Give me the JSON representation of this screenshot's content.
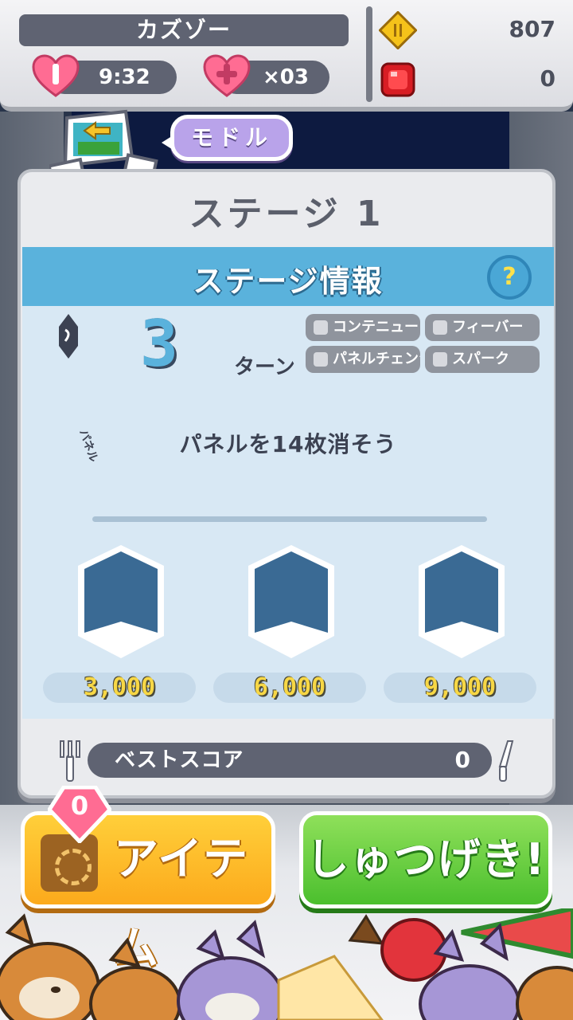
{
  "header": {
    "player_name": "カズゾー",
    "stamina_timer": "9:32",
    "heart_count": "×03",
    "gold": "807",
    "gems": "0"
  },
  "back": {
    "label": "モドル"
  },
  "stage": {
    "title": "ステージ 1",
    "info_title": "ステージ情報",
    "help_label": "?",
    "turn_tag": "ターン",
    "turns": "3",
    "turn_label": "ターン",
    "skills": [
      "コンテニュー",
      "フィーバー",
      "パネルチェンジ",
      "スパーク"
    ],
    "goal_tag": "パネル",
    "goal_text": "パネルを14枚消そう",
    "score_targets": [
      "3,000",
      "6,000",
      "9,000"
    ]
  },
  "best_score": {
    "label": "ベストスコア",
    "value": "0"
  },
  "actions": {
    "item_label": "アイテム",
    "item_badge": "0",
    "sortie_label": "しゅつげき!"
  },
  "colors": {
    "accent_blue": "#5ab2dc",
    "item_orange": "#fcaa1c",
    "sortie_green": "#4bbf2e",
    "medal_fill": "#3a6a94",
    "score_yellow": "#f7d745"
  }
}
